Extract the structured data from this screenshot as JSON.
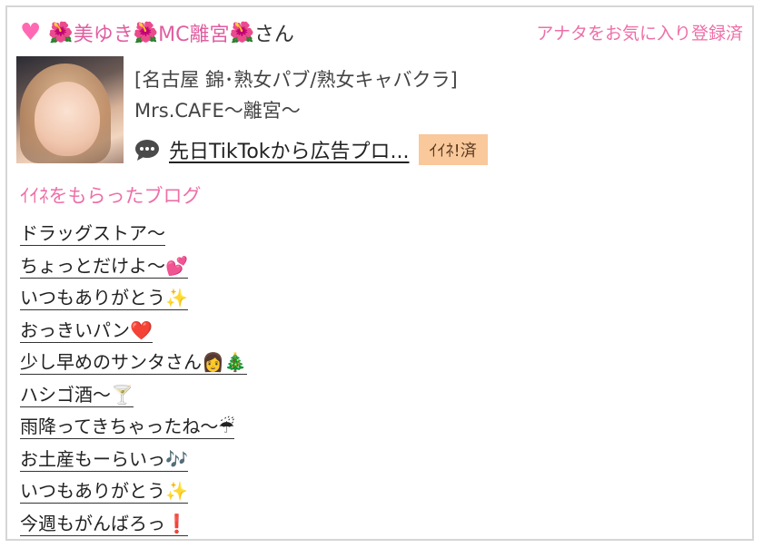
{
  "card": {
    "owner_prefix_emoji": "🌺",
    "owner_name_1": "美ゆき",
    "owner_mid_emoji": "🌺",
    "owner_name_2": "MC離宮",
    "owner_suffix_emoji": "🌺",
    "owner_honorific": "さん",
    "favorite_link": "アナタをお気に入り登録済",
    "heart_color": "#ff69b4"
  },
  "shop": {
    "category": "[名古屋 錦･熟女パブ/熟女キャバクラ]",
    "name": "Mrs.CAFE〜離宮〜",
    "latest_blog_title": "先日TikTokから広告プロ...",
    "iine_badge": "ｲｲﾈ!済"
  },
  "section": {
    "title": "ｲｲﾈをもらったブログ"
  },
  "blogs": [
    "ドラッグストア〜",
    "ちょっとだけよ〜💕",
    "いつもありがとう✨",
    "おっきいパン❤️",
    "少し早めのサンタさん👩‍🎄",
    "ハシゴ酒〜🍸",
    "雨降ってきちゃったね〜☔",
    "お土産もーらいっ🎶",
    "いつもありがとう✨",
    "今週もがんばろっ❗"
  ],
  "colors": {
    "accent_pink": "#ee6fa8",
    "badge_bg": "#f9c89b"
  }
}
